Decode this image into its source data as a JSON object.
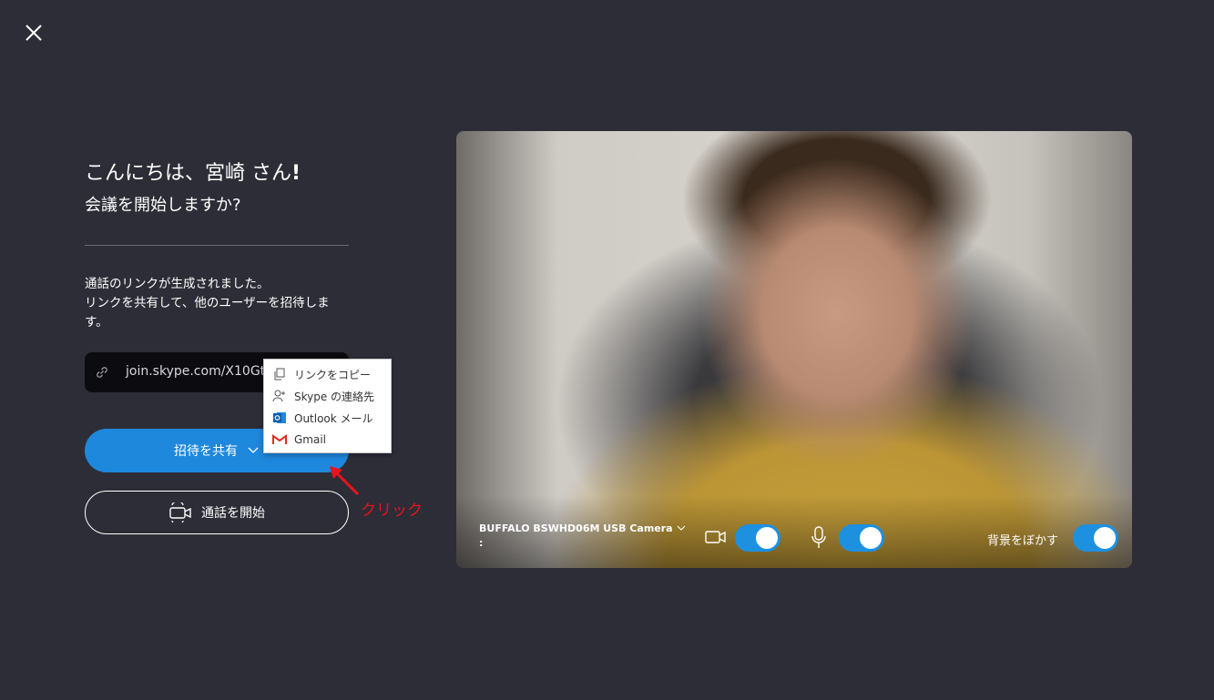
{
  "close": {
    "icon": "close-icon"
  },
  "greeting": {
    "text": "こんにちは、宮崎 さん",
    "exclaim": "!",
    "subtitle": "会議を開始しますか?"
  },
  "description": {
    "line1": "通話のリンクが生成されました。",
    "line2": "リンクを共有して、他のユーザーを招待します。"
  },
  "link": {
    "url": "join.skype.com/X10GtK"
  },
  "buttons": {
    "share": "招待を共有",
    "start": "通話を開始"
  },
  "menu": {
    "items": [
      {
        "label": "リンクをコピー",
        "icon": "copy-icon"
      },
      {
        "label": "Skype の連絡先",
        "icon": "add-contact-icon"
      },
      {
        "label": "Outlook メール",
        "icon": "outlook-icon"
      },
      {
        "label": "Gmail",
        "icon": "gmail-icon"
      }
    ]
  },
  "annotation": {
    "text": "クリック",
    "color": "#e8141a"
  },
  "video": {
    "camera_name": "BUFFALO BSWHD06M USB Camera",
    "camera_suffix": ":",
    "video_on": true,
    "mic_on": true,
    "blur_label": "背景をぼかす",
    "blur_on": true
  },
  "colors": {
    "background": "#2d2d37",
    "accent": "#1e88dc",
    "toggle": "#1e90e0"
  }
}
